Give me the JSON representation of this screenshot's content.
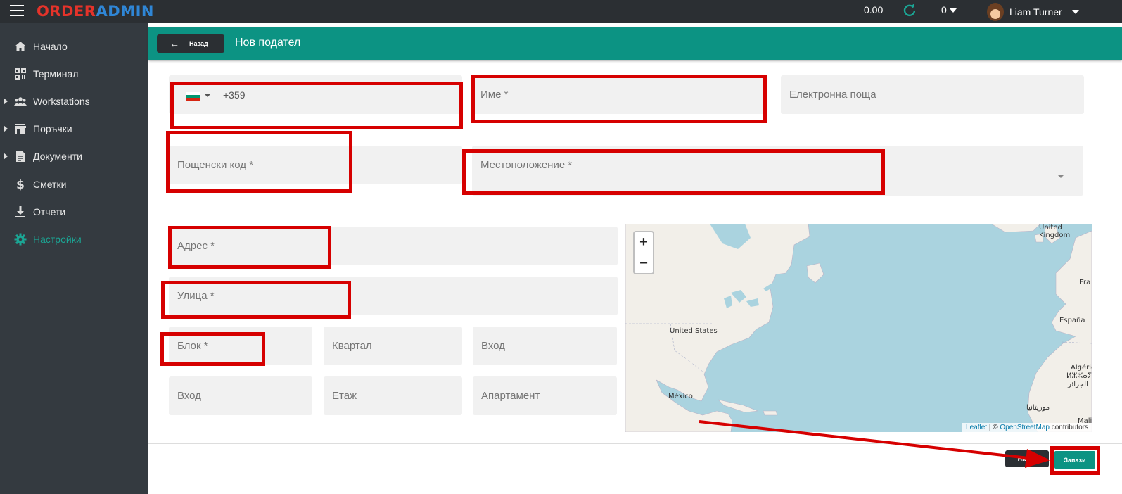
{
  "app": {
    "logo_part1": "ORDER",
    "logo_part2": "ADMIN",
    "balance": "0.00",
    "counter": "0",
    "user_name": "Liam Turner"
  },
  "sidebar": {
    "items": [
      {
        "label": "Начало",
        "icon": "home-icon"
      },
      {
        "label": "Терминал",
        "icon": "qr-code-icon"
      },
      {
        "label": "Workstations",
        "icon": "users-icon"
      },
      {
        "label": "Поръчки",
        "icon": "store-icon"
      },
      {
        "label": "Документи",
        "icon": "document-icon"
      },
      {
        "label": "Сметки",
        "icon": "dollar-icon"
      },
      {
        "label": "Отчети",
        "icon": "download-icon"
      },
      {
        "label": "Настройки",
        "icon": "gear-icon"
      }
    ],
    "active_color": "#1ba695"
  },
  "header": {
    "back_label": "Назад",
    "title": "Нов подател",
    "color": "#0c9383"
  },
  "form": {
    "phone_code": "+359",
    "phone_country": "Bulgaria",
    "name_placeholder": "Име *",
    "email_placeholder": "Електронна поща",
    "postcode_placeholder": "Пощенски код *",
    "location_placeholder": "Местоположение *",
    "address_placeholder": "Адрес *",
    "street_placeholder": "Улица *",
    "block_placeholder": "Блок *",
    "quarter_placeholder": "Квартал",
    "entrance1_placeholder": "Вход",
    "entrance2_placeholder": "Вход",
    "floor_placeholder": "Етаж",
    "apartment_placeholder": "Апартамент"
  },
  "map": {
    "zoom_in": "+",
    "zoom_out": "−",
    "labels": {
      "uk": "United Kingdom",
      "fr": "Fra",
      "us": "United States",
      "es": "España",
      "dz": "Algérie",
      "dz_tifinagh": "ⵍⵣⵣⴰⵢⴻ",
      "dz_arabic": "الجزائر",
      "ma_arabic": "موريتانيا",
      "mx": "México",
      "ml": "Mali"
    },
    "attribution_leaflet": "Leaflet",
    "attribution_sep": " | © ",
    "attribution_osm": "OpenStreetMap",
    "attribution_suffix": " contributors"
  },
  "footer": {
    "back_label": "Назад",
    "save_label": "Запази"
  },
  "annotation_color": "#d60000"
}
